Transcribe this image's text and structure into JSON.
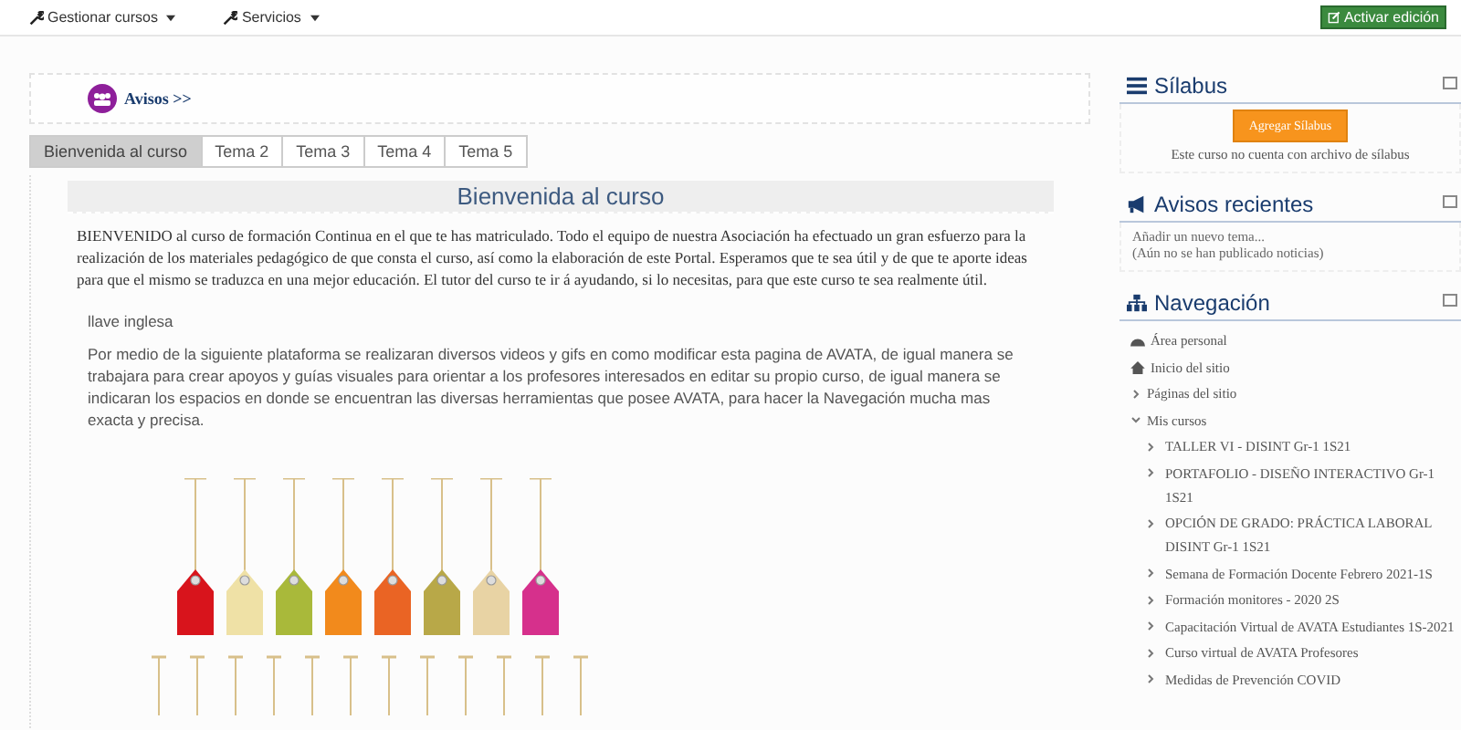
{
  "menu": [
    {
      "label": "Gestionar cursos"
    },
    {
      "label": "Servicios"
    }
  ],
  "edit_button": {
    "label": "Activar edición"
  },
  "announcements_link": {
    "label": "Avisos >>"
  },
  "tabs": [
    {
      "label": "Bienvenida al curso",
      "selected": true
    },
    {
      "label": "Tema 2",
      "selected": false
    },
    {
      "label": "Tema 3",
      "selected": false
    },
    {
      "label": "Tema 4",
      "selected": false
    },
    {
      "label": "Tema 5",
      "selected": false
    }
  ],
  "section": {
    "title": "Bienvenida al curso",
    "intro": "BIENVENIDO al curso de formación Continua en el que te has matriculado. Todo el equipo de nuestra Asociación ha efectuado un gran esfuerzo para la realización de los materiales pedagógico de que consta el curso, así como la elaboración de este Portal. Esperamos que te sea útil y de que te aporte ideas para que el mismo se traduzca en una mejor educación. El tutor del curso te ir á ayudando, si lo necesitas, para que este curso te sea realmente útil.",
    "image_alt": "llave inglesa",
    "body": "Por medio de la siguiente plataforma se realizaran diversos videos y gifs en como modificar esta pagina de AVATA, de igual manera se trabajara para crear apoyos y guías visuales para orientar a los profesores interesados en editar su propio curso, de igual manera se indicaran los espacios en donde se encuentran las diversas herramientas que posee AVATA, para hacer la Navegación mucha mas exacta y precisa."
  },
  "syllabus": {
    "title": "Sílabus",
    "button": "Agregar Sílabus",
    "note": "Este curso no cuenta con archivo de sílabus"
  },
  "recent_news": {
    "title": "Avisos recientes",
    "add_link": "Añadir un nuevo tema...",
    "note": "(Aún no se han publicado noticias)"
  },
  "navigation": {
    "title": "Navegación",
    "items": [
      {
        "label": "Área personal",
        "kind": "home"
      },
      {
        "label": "Inicio del sitio",
        "kind": "site"
      },
      {
        "label": "Páginas del sitio",
        "kind": "branch",
        "expanded": false
      },
      {
        "label": "Mis cursos",
        "kind": "branch",
        "expanded": true,
        "children": [
          {
            "label": "TALLER VI - DISINT Gr-1 1S21",
            "kind": "branch",
            "expanded": false
          },
          {
            "label": "PORTAFOLIO - DISEÑO INTERACTIVO Gr-1 1S21",
            "kind": "branch",
            "expanded": false
          },
          {
            "label": "OPCIÓN DE GRADO: PRÁCTICA LABORAL DISINT Gr-1 1S21",
            "kind": "branch",
            "expanded": false
          },
          {
            "label": "Semana de Formación Docente Febrero 2021-1S",
            "kind": "branch",
            "expanded": false
          },
          {
            "label": "Formación monitores - 2020 2S",
            "kind": "branch",
            "expanded": false
          },
          {
            "label": "Capacitación Virtual de AVATA Estudiantes 1S-2021",
            "kind": "branch",
            "expanded": false
          },
          {
            "label": "Curso virtual de AVATA Profesores",
            "kind": "branch",
            "expanded": false
          },
          {
            "label": "Medidas de Prevención COVID",
            "kind": "branch",
            "expanded": false
          }
        ]
      }
    ]
  }
}
